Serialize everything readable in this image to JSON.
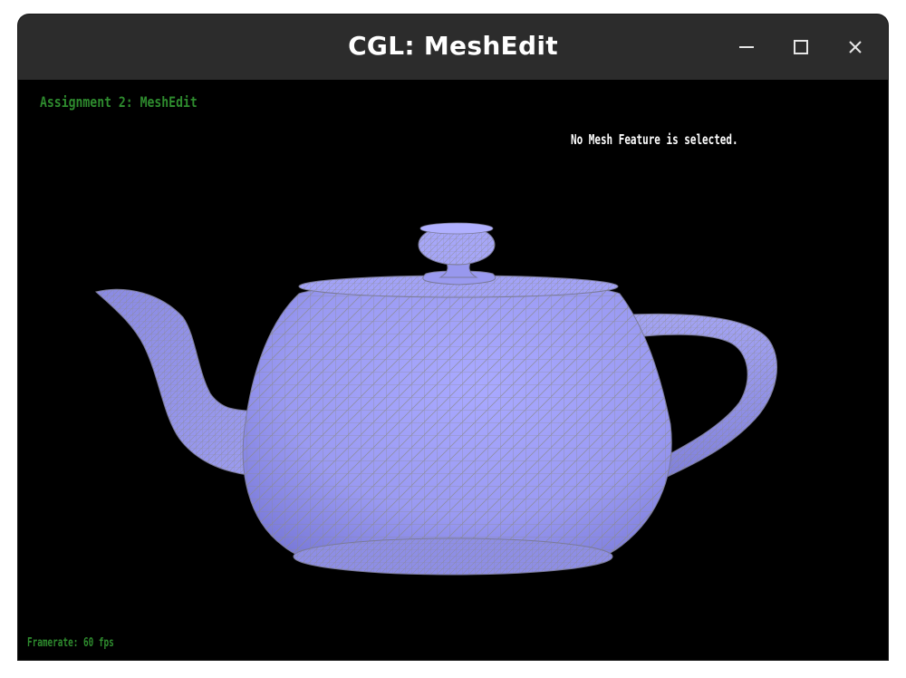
{
  "window": {
    "title": "CGL: MeshEdit",
    "controls": {
      "minimize_icon": "minimize-icon",
      "maximize_icon": "maximize-icon",
      "close_icon": "close-icon"
    },
    "titlebar_color": "#2c2c2c"
  },
  "viewport": {
    "background": "#000000",
    "assignment_label": "Assignment 2: MeshEdit",
    "selection_status": "No Mesh Feature is selected.",
    "framerate_label": "Framerate: 60 fps",
    "hud_green": "#2e8b2e",
    "mesh_fill": "#9a9af2",
    "mesh_wire": "#8a8a8a"
  }
}
